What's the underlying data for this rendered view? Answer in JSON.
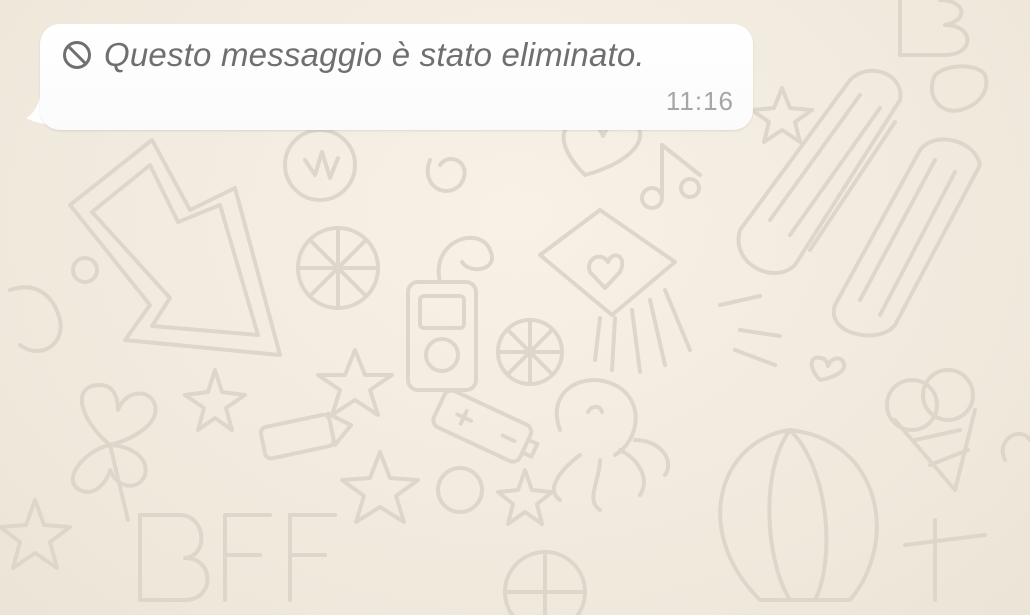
{
  "chat": {
    "background_color": "#f4eee2",
    "wallpaper_doodles": [
      "arrow-doodle",
      "heart-doodle",
      "music-note-doodle",
      "gift-box-doodle",
      "orange-slice-doodle",
      "mp3-player-doodle",
      "star-doodle",
      "clover-doodle",
      "battery-doodle",
      "octopus-doodle",
      "ice-cream-doodle",
      "hot-air-balloon-doodle",
      "bff-letters-doodle",
      "crayon-doodle",
      "inflatable-mattress-doodle"
    ],
    "message": {
      "direction": "incoming",
      "icon": "prohibited-icon",
      "text": "Questo messaggio è stato eliminato.",
      "time": "11:16",
      "bubble_color": "#ffffff",
      "text_color": "#6f6f6f",
      "time_color": "#a6a6a6"
    }
  }
}
